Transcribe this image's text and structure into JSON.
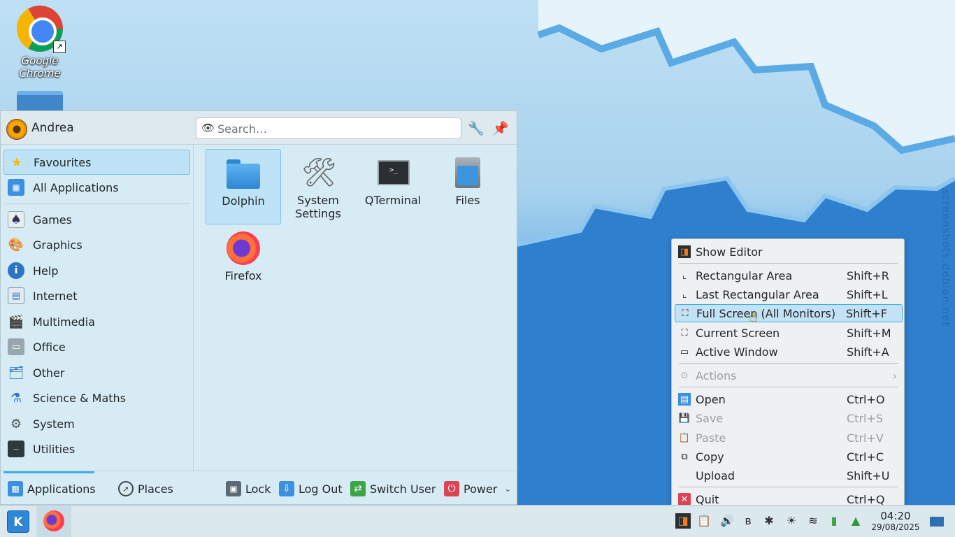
{
  "desktop": {
    "chrome_label": "Google Chrome",
    "watermark": "screenshots.debian.net"
  },
  "launcher": {
    "user_name": "Andrea",
    "search_placeholder": "Search…",
    "sidebar": [
      {
        "label": "Favourites",
        "icon": "star-icon",
        "active": true
      },
      {
        "label": "All Applications",
        "icon": "grid-icon"
      },
      {
        "label": "Games",
        "icon": "games-icon"
      },
      {
        "label": "Graphics",
        "icon": "palette-icon"
      },
      {
        "label": "Help",
        "icon": "help-icon"
      },
      {
        "label": "Internet",
        "icon": "internet-icon"
      },
      {
        "label": "Multimedia",
        "icon": "multimedia-icon"
      },
      {
        "label": "Office",
        "icon": "office-icon"
      },
      {
        "label": "Other",
        "icon": "other-icon"
      },
      {
        "label": "Science & Maths",
        "icon": "science-icon"
      },
      {
        "label": "System",
        "icon": "system-icon"
      },
      {
        "label": "Utilities",
        "icon": "utilities-icon"
      }
    ],
    "favourites": [
      {
        "label": "Dolphin",
        "icon": "folder-icon"
      },
      {
        "label": "System Settings",
        "icon": "tools-icon"
      },
      {
        "label": "QTerminal",
        "icon": "terminal-icon"
      },
      {
        "label": "Files",
        "icon": "files-icon"
      },
      {
        "label": "Firefox",
        "icon": "firefox-icon"
      }
    ],
    "footer": {
      "applications": "Applications",
      "places": "Places",
      "lock": "Lock",
      "logout": "Log Out",
      "switch_user": "Switch User",
      "power": "Power"
    }
  },
  "context_menu": {
    "items": [
      {
        "label": "Show Editor",
        "shortcut": ""
      },
      {
        "label": "Rectangular Area",
        "shortcut": "Shift+R"
      },
      {
        "label": "Last Rectangular Area",
        "shortcut": "Shift+L"
      },
      {
        "label": "Full Screen (All Monitors)",
        "shortcut": "Shift+F",
        "highlighted": true
      },
      {
        "label": "Current Screen",
        "shortcut": "Shift+M"
      },
      {
        "label": "Active Window",
        "shortcut": "Shift+A"
      },
      {
        "label": "Actions",
        "shortcut": "",
        "disabled": true
      },
      {
        "label": "Open",
        "shortcut": "Ctrl+O"
      },
      {
        "label": "Save",
        "shortcut": "Ctrl+S",
        "disabled": true
      },
      {
        "label": "Paste",
        "shortcut": "Ctrl+V",
        "disabled": true
      },
      {
        "label": "Copy",
        "shortcut": "Ctrl+C"
      },
      {
        "label": "Upload",
        "shortcut": "Shift+U"
      },
      {
        "label": "Quit",
        "shortcut": "Ctrl+Q"
      }
    ]
  },
  "taskbar": {
    "time": "04:20",
    "date": "29/08/2025"
  },
  "colors": {
    "accent": "#3daee9",
    "panel": "#dbe8ee"
  }
}
